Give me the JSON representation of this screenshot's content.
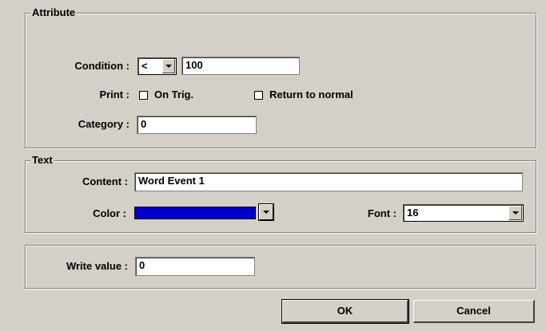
{
  "attribute": {
    "legend": "Attribute",
    "condition_label": "Condition :",
    "condition_operator": "<",
    "condition_value": "100",
    "print_label": "Print :",
    "on_trig_label": "On Trig.",
    "on_trig_checked": false,
    "return_normal_label": "Return to normal",
    "return_normal_checked": false,
    "category_label": "Category :",
    "category_value": "0"
  },
  "text": {
    "legend": "Text",
    "content_label": "Content :",
    "content_value": "Word Event 1",
    "color_label": "Color :",
    "color_value": "#0000cc",
    "font_label": "Font :",
    "font_value": "16"
  },
  "write": {
    "label": "Write value :",
    "value": "0"
  },
  "buttons": {
    "ok": "OK",
    "cancel": "Cancel"
  }
}
